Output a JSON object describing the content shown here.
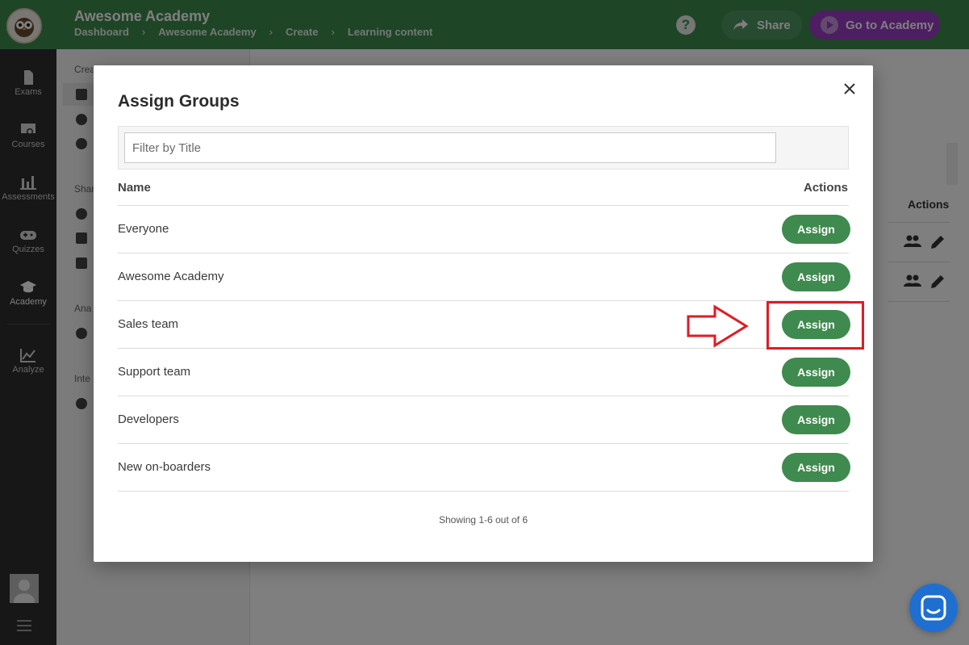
{
  "header": {
    "app_title": "Awesome Academy",
    "breadcrumbs": [
      "Dashboard",
      "Awesome Academy",
      "Create",
      "Learning content"
    ],
    "help_label": "?",
    "share_label": "Share",
    "go_label": "Go to Academy"
  },
  "sidebar": {
    "items": [
      {
        "label": "Exams",
        "icon": "document-icon"
      },
      {
        "label": "Courses",
        "icon": "certificate-icon"
      },
      {
        "label": "Assessments",
        "icon": "bar-chart-icon"
      },
      {
        "label": "Quizzes",
        "icon": "gamepad-icon"
      },
      {
        "label": "Academy",
        "icon": "graduation-cap-icon"
      },
      {
        "label": "Analyze",
        "icon": "line-chart-icon"
      }
    ]
  },
  "subnav": {
    "headings": [
      "Crea",
      "Shar",
      "Ana",
      "Inte"
    ]
  },
  "background_table": {
    "actions_header": "Actions"
  },
  "modal": {
    "title": "Assign Groups",
    "filter_placeholder": "Filter by Title",
    "filter_value": "",
    "columns": {
      "name": "Name",
      "actions": "Actions"
    },
    "assign_label": "Assign",
    "groups": [
      {
        "name": "Everyone"
      },
      {
        "name": "Awesome Academy"
      },
      {
        "name": "Sales team"
      },
      {
        "name": "Support team"
      },
      {
        "name": "Developers"
      },
      {
        "name": "New on-boarders"
      }
    ],
    "pagination": "Showing 1-6 out of 6"
  },
  "colors": {
    "brand_green": "#3f8a4f",
    "academy_purple": "#9a3dc2",
    "annotation_red": "#e01b24",
    "chat_blue": "#1f6fd1"
  }
}
